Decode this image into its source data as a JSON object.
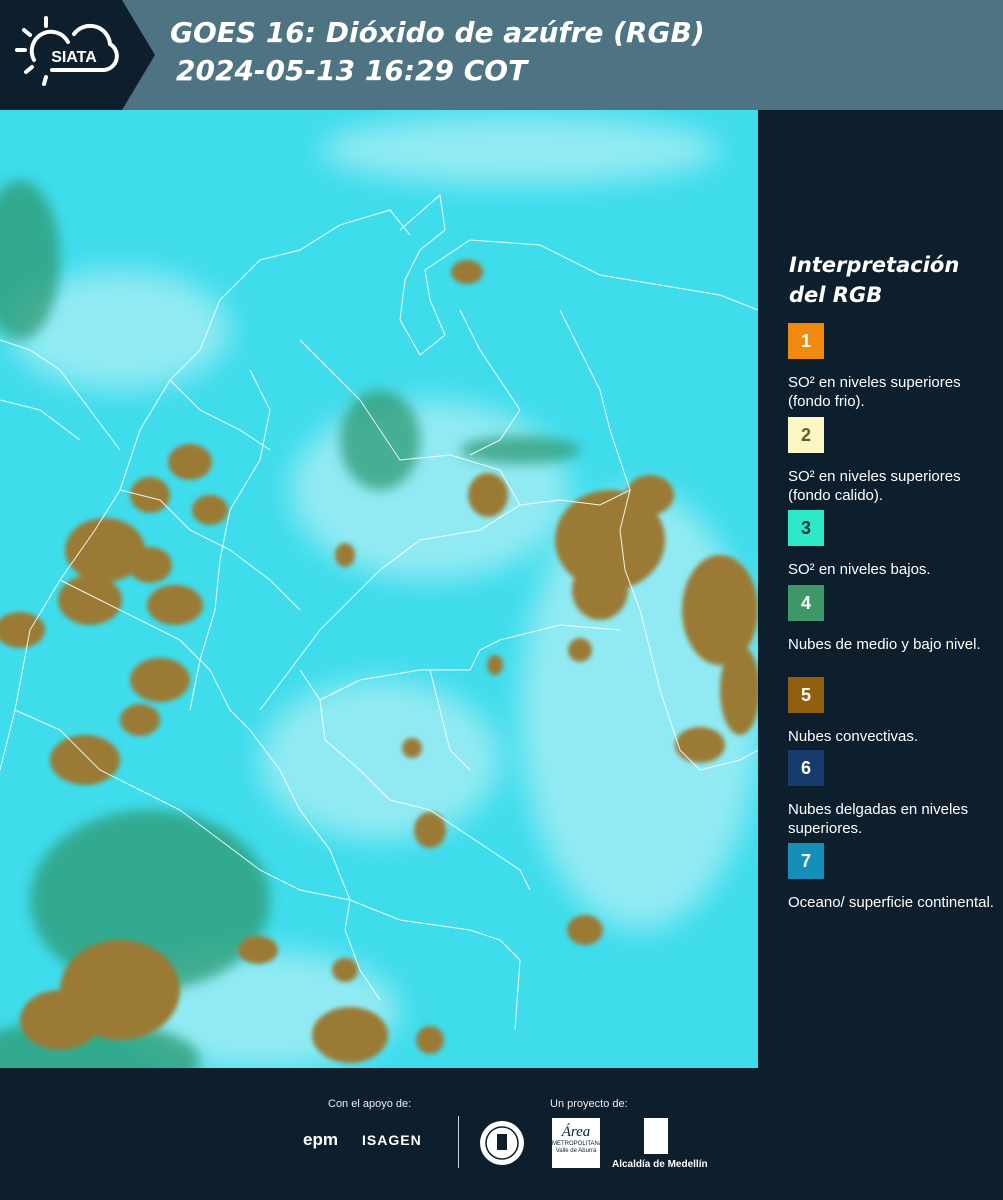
{
  "header": {
    "logo_text": "SIATA",
    "title_line1": "GOES 16: Dióxido de azúfre (RGB)",
    "title_line2": "2024-05-13 16:29 COT",
    "background": "#4e7484",
    "logo_background": "#0d1f2d"
  },
  "legend": {
    "title_line1": "Interpretación",
    "title_line2": "del RGB",
    "items": [
      {
        "number": "1",
        "color": "#f08a0f",
        "text_color": "#ffffff",
        "label": "SO² en niveles superiores (fondo frio)."
      },
      {
        "number": "2",
        "color": "#fbf6c4",
        "text_color": "#6b5a20",
        "label": "SO² en niveles superiores (fondo calido)."
      },
      {
        "number": "3",
        "color": "#2ce8c9",
        "text_color": "#0d3b3a",
        "label": "SO² en niveles bajos."
      },
      {
        "number": "4",
        "color": "#3f9666",
        "text_color": "#ffffff",
        "label": "Nubes de medio y bajo nivel."
      },
      {
        "number": "5",
        "color": "#91600e",
        "text_color": "#ffffff",
        "label": "Nubes convectivas."
      },
      {
        "number": "6",
        "color": "#163b6c",
        "text_color": "#ffffff",
        "label": "Nubes delgadas en niveles superiores."
      },
      {
        "number": "7",
        "color": "#168fb8",
        "text_color": "#ffffff",
        "label": "Oceano/ superficie continental."
      }
    ]
  },
  "map": {
    "background_color": "#3fdcec",
    "cloud_color": "#9a7a34",
    "border_color": "#ffffff"
  },
  "footer": {
    "support_label": "Con el apoyo de:",
    "project_label": "Un proyecto de:",
    "epm_text": "epm",
    "isagen_text": "ISAGEN",
    "area_text": "Área",
    "area_sub": "METROPOLITANA Valle de Aburrá",
    "alcaldia_text": "Alcaldía de Medellín"
  }
}
